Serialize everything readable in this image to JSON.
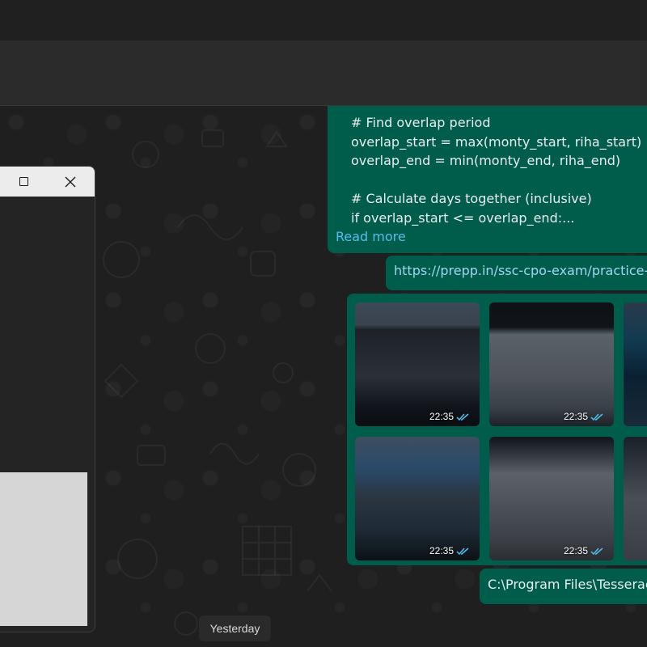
{
  "colors": {
    "outgoing_bubble": "#005c4b",
    "chat_background": "#1f1f1f",
    "link": "#53bdeb",
    "read_ticks": "#53bdeb"
  },
  "window_controls": {
    "maximize_icon": "maximize-icon",
    "close_icon": "close-icon"
  },
  "messages": {
    "code": {
      "lines": [
        "# Find overlap period",
        "overlap_start = max(monty_start, riha_start)",
        "overlap_end = min(monty_end, riha_end)",
        "",
        "# Calculate days together (inclusive)",
        "if overlap_start <= overlap_end:..."
      ],
      "read_more": "Read more"
    },
    "link": "https://prepp.in/ssc-cpo-exam/practice-p",
    "media": [
      {
        "time": "22:35"
      },
      {
        "time": "22:35"
      },
      {
        "time": ""
      },
      {
        "time": "22:35"
      },
      {
        "time": "22:35"
      },
      {
        "time": ""
      }
    ],
    "path": "C:\\Program Files\\Tesserac"
  },
  "date_separator": "Yesterday"
}
